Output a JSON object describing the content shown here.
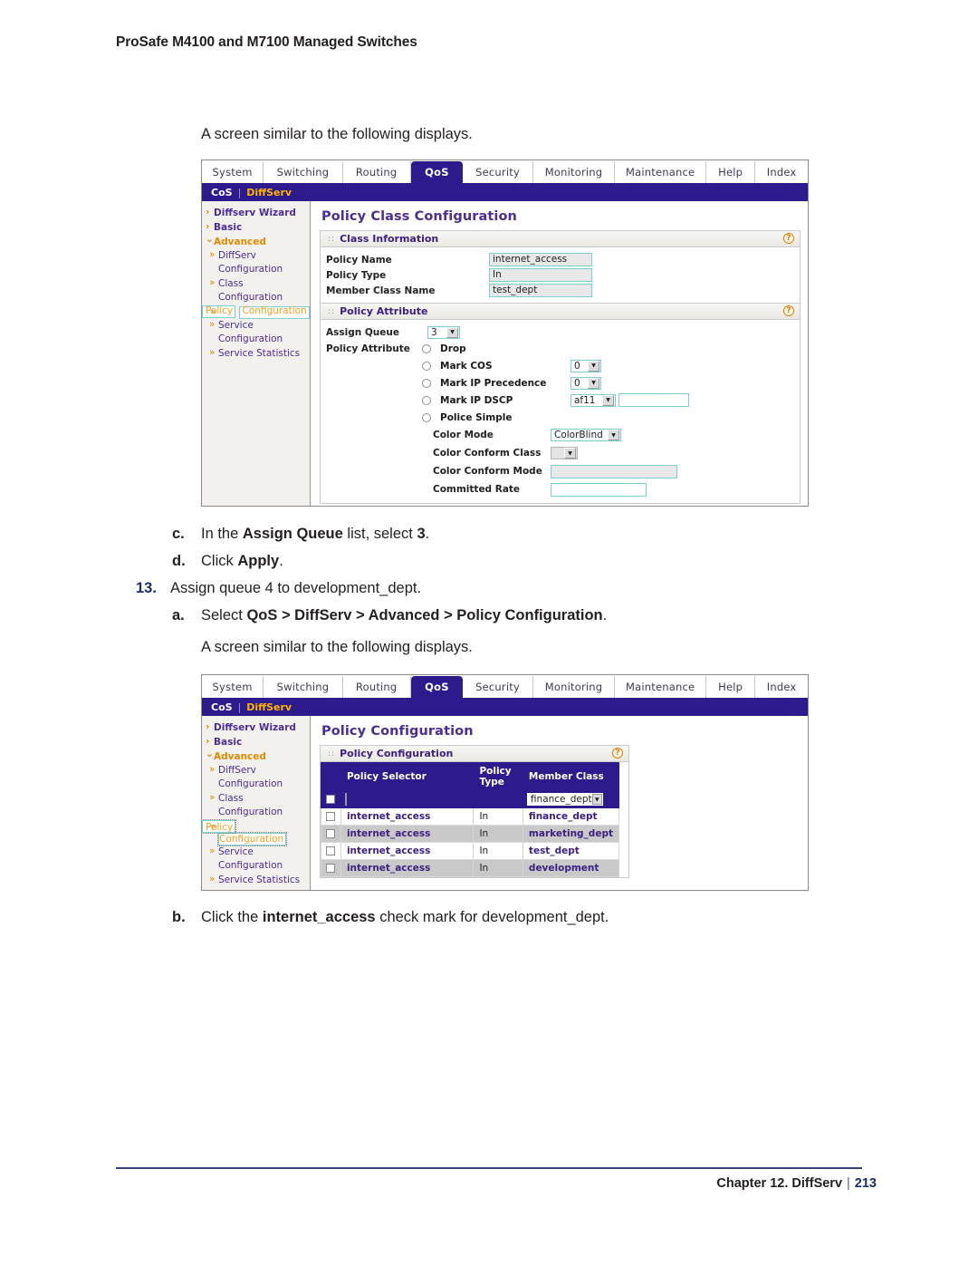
{
  "page": {
    "header": "ProSafe M4100 and M7100 Managed Switches",
    "footer_chapter": "Chapter 12.  DiffServ",
    "footer_sep": "|",
    "footer_page": "213"
  },
  "body": {
    "lead_1": "A screen similar to the following displays.",
    "lead_2": "A screen similar to the following displays.",
    "step_c_marker": "c.",
    "step_c_text_1": "In the ",
    "step_c_bold_1": "Assign Queue",
    "step_c_text_2": " list, select ",
    "step_c_bold_2": "3",
    "step_c_text_3": ".",
    "step_d_marker": "d.",
    "step_d_text_1": "Click ",
    "step_d_bold_1": "Apply",
    "step_d_text_2": ".",
    "step_13_marker": "13.",
    "step_13_text": "Assign queue 4 to development_dept.",
    "step_a_marker": "a.",
    "step_a_text_1": "Select ",
    "step_a_bold_1": "QoS > DiffServ > Advanced > Policy Configuration",
    "step_a_text_2": ".",
    "step_b_marker": "b.",
    "step_b_text_1": "Click the ",
    "step_b_bold_1": "internet_access",
    "step_b_text_2": " check mark for development_dept."
  },
  "switch_ui": {
    "tabs": [
      {
        "label": "System",
        "active": false
      },
      {
        "label": "Switching",
        "active": false
      },
      {
        "label": "Routing",
        "active": false
      },
      {
        "label": "QoS",
        "active": true
      },
      {
        "label": "Security",
        "active": false
      },
      {
        "label": "Monitoring",
        "active": false
      },
      {
        "label": "Maintenance",
        "active": false
      },
      {
        "label": "Help",
        "active": false
      },
      {
        "label": "Index",
        "active": false
      }
    ],
    "subnav": {
      "item_1": "CoS",
      "separator": "|",
      "item_2": "DiffServ"
    },
    "sidebar": {
      "wizard": "Diffserv Wizard",
      "basic": "Basic",
      "advanced": "Advanced",
      "diffserv": "DiffServ",
      "diffserv_cont": "Configuration",
      "class": "Class",
      "class_cont": "Configuration",
      "policy": "Policy",
      "policy_cont": "Configuration",
      "service": "Service",
      "service_cont": "Configuration",
      "service_stats": "Service Statistics"
    },
    "colors": {
      "nav_purple": "#2d1a8c",
      "link_purple": "#4b2d96",
      "accent_orange": "#e08a00",
      "selected_orange": "#f0a020",
      "help_orange": "#d9820b",
      "field_border_teal": "#7ecece"
    }
  },
  "screen_1": {
    "title": "Policy Class Configuration",
    "class_info": {
      "panel_title": "Class Information",
      "help": "?",
      "rows": [
        {
          "label": "Policy Name",
          "value": "internet_access"
        },
        {
          "label": "Policy Type",
          "value": "In"
        },
        {
          "label": "Member Class Name",
          "value": "test_dept"
        }
      ]
    },
    "policy_attribute": {
      "panel_title": "Policy Attribute",
      "help": "?",
      "assign_queue_label": "Assign Queue",
      "assign_queue_value": "3",
      "attribute_label": "Policy Attribute",
      "options": [
        {
          "label": "Drop",
          "control": "none",
          "value": ""
        },
        {
          "label": "Mark COS",
          "control": "select",
          "value": "0"
        },
        {
          "label": "Mark IP Precedence",
          "control": "select",
          "value": "0"
        },
        {
          "label": "Mark IP DSCP",
          "control": "select_text",
          "value": "af11",
          "text_value": ""
        },
        {
          "label": "Police Simple",
          "control": "none",
          "value": ""
        }
      ],
      "police_rows": [
        {
          "label": "Color Mode",
          "type": "select",
          "value": "ColorBlind"
        },
        {
          "label": "Color Conform Class",
          "type": "select_gray",
          "value": ""
        },
        {
          "label": "Color Conform Mode",
          "type": "text_gray",
          "value": ""
        },
        {
          "label": "Committed Rate",
          "type": "text_empty",
          "value": ""
        }
      ]
    }
  },
  "screen_2": {
    "title": "Policy Configuration",
    "panel_title": "Policy Configuration",
    "help": "?",
    "table": {
      "headers": [
        "",
        "Policy Selector",
        "Policy Type",
        "Member Class"
      ],
      "filter_row": {
        "selector_value": "",
        "type_value": "",
        "member_class_value": "finance_dept"
      },
      "rows": [
        {
          "selector": "internet_access",
          "type": "In",
          "member_class": "finance_dept",
          "alt": false
        },
        {
          "selector": "internet_access",
          "type": "In",
          "member_class": "marketing_dept",
          "alt": true
        },
        {
          "selector": "internet_access",
          "type": "In",
          "member_class": "test_dept",
          "alt": false
        },
        {
          "selector": "internet_access",
          "type": "In",
          "member_class": "development",
          "alt": true
        }
      ]
    }
  }
}
